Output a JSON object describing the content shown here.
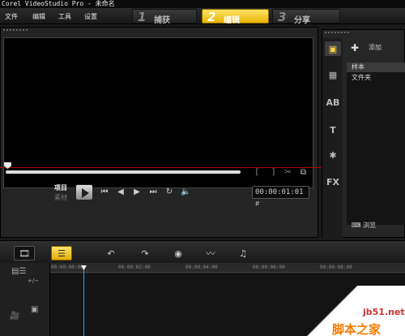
{
  "window": {
    "title": "Corel VideoStudio Pro - 未命名"
  },
  "menu": {
    "items": [
      "文件",
      "编辑",
      "工具",
      "设置"
    ]
  },
  "steps": [
    {
      "num": "1",
      "label": "捕获",
      "active": false
    },
    {
      "num": "2",
      "label": "编辑",
      "active": true
    },
    {
      "num": "3",
      "label": "分享",
      "active": false
    }
  ],
  "player": {
    "mode_project": "项目",
    "mode_clip": "素材",
    "timecode": "00:00:01:01"
  },
  "library": {
    "add_label": "添加",
    "folders": [
      "样本",
      "文件夹"
    ],
    "selected_folder": "样本",
    "browse_label": "浏览"
  },
  "timeline": {
    "ruler_labels": [
      "00:00:00:00",
      "00:00:02:00",
      "00:00:04:00",
      "00:00:06:00",
      "00:00:08:00"
    ]
  },
  "watermark": {
    "url": "jb51.net",
    "name": "脚本之家"
  }
}
